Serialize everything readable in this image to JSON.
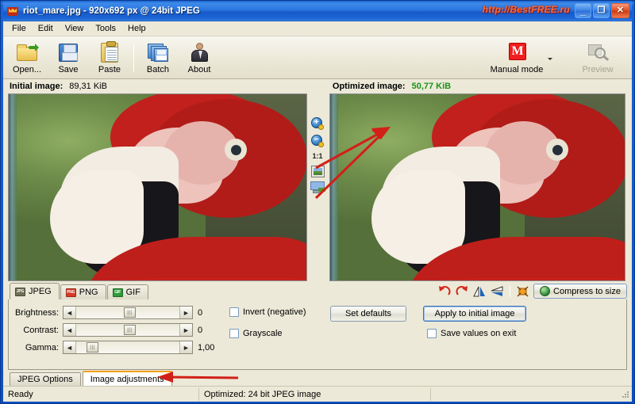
{
  "window": {
    "title": "riot_mare.jpg - 920x692 px @ 24bit JPEG",
    "watermark": "http://BestFREE.ru",
    "minimize": "_",
    "maximize": "❐",
    "close": "✕"
  },
  "menu": {
    "items": [
      "File",
      "Edit",
      "View",
      "Tools",
      "Help"
    ]
  },
  "toolbar": {
    "buttons": [
      {
        "label": "Open...",
        "icon": "open-folder-icon"
      },
      {
        "label": "Save",
        "icon": "floppy-disk-icon"
      },
      {
        "label": "Paste",
        "icon": "clipboard-icon"
      },
      {
        "label": "Batch",
        "icon": "batch-images-icon"
      },
      {
        "label": "About",
        "icon": "person-icon"
      }
    ],
    "mode": {
      "label": "Manual mode",
      "icon": "manual-mode-m-icon"
    },
    "preview": {
      "label": "Preview",
      "icon": "magnifier-icon",
      "disabled": true
    }
  },
  "panes": {
    "left": {
      "label": "Initial image:",
      "value": "89,31 KiB"
    },
    "right": {
      "label": "Optimized image:",
      "value": "50,77 KiB",
      "value_color": "#1a9418"
    }
  },
  "center_tools": {
    "zoom_in": "+",
    "zoom_out": "−",
    "actual_size": "1:1",
    "fit_image": "fit-image-icon",
    "fit_window": "fit-window-icon"
  },
  "format_tabs": [
    {
      "label": "JPEG",
      "icon": "jpeg-icon",
      "badge": "JPG",
      "active": true
    },
    {
      "label": "PNG",
      "icon": "png-icon",
      "badge": "PNG",
      "active": false
    },
    {
      "label": "GIF",
      "icon": "gif-icon",
      "badge": "GIF",
      "active": false
    }
  ],
  "image_actions": {
    "rotate_left": "rotate-left-icon",
    "rotate_right": "rotate-right-icon",
    "flip_horizontal": "flip-horizontal-icon",
    "flip_vertical": "flip-vertical-icon",
    "resize": "resize-icon",
    "compress_label": "Compress to size"
  },
  "adjustments": {
    "sliders": [
      {
        "name": "Brightness:",
        "value": "0",
        "thumb_pct": 50
      },
      {
        "name": "Contrast:",
        "value": "0",
        "thumb_pct": 50
      },
      {
        "name": "Gamma:",
        "value": "1,00",
        "thumb_pct": 12
      }
    ],
    "checkboxes": [
      {
        "label": "Invert (negative)",
        "checked": false
      },
      {
        "label": "Grayscale",
        "checked": false
      }
    ],
    "set_defaults": "Set defaults",
    "apply": "Apply to initial image",
    "save_on_exit": {
      "label": "Save values on exit",
      "checked": false
    }
  },
  "bottom_tabs": [
    {
      "label": "JPEG Options",
      "active": false
    },
    {
      "label": "Image adjustments",
      "active": true
    }
  ],
  "status": {
    "left": "Ready",
    "middle": "Optimized: 24 bit JPEG image",
    "right": ""
  },
  "colors": {
    "accent_blue": "#1a62d6",
    "green_value": "#1a9418",
    "annotation_red": "#d22018",
    "active_tab_orange": "#f3a01a",
    "face_bg": "#ece9d8"
  }
}
